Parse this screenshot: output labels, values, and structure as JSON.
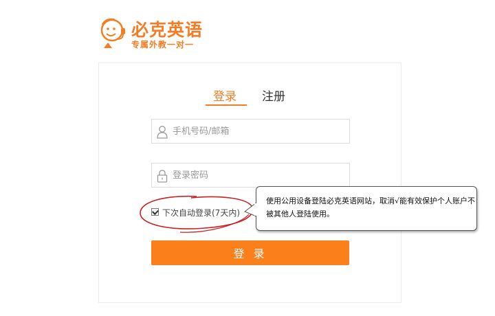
{
  "brand": {
    "name": "必克英语",
    "slogan": "专属外教一对一"
  },
  "tabs": [
    {
      "label": "登录",
      "active": true
    },
    {
      "label": "注册",
      "active": false
    }
  ],
  "form": {
    "username_placeholder": "手机号码/邮箱",
    "password_placeholder": "登录密码",
    "remember_label": "下次自动登录(7天内)",
    "remember_checked": true,
    "submit_label": "登 录"
  },
  "tooltip": {
    "text": "使用公用设备登陆必克英语网站，取消√能有效保护个人账户不被其他人登陆使用。"
  },
  "colors": {
    "accent": "#f47d23",
    "button": "#fb7f1b",
    "annotation": "#cc1f1f"
  },
  "icons": {
    "logo": "smiling-headset-face-icon",
    "username": "user-icon",
    "password": "lock-icon"
  }
}
